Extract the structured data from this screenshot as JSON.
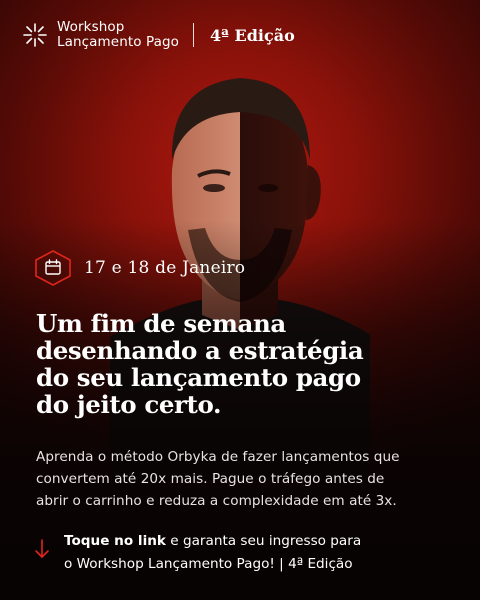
{
  "header": {
    "brand_line1": "Workshop",
    "brand_line2": "Lançamento Pago",
    "edition": "4ª Edição",
    "logo_icon": "starburst-icon"
  },
  "date": {
    "icon": "calendar-icon",
    "text": "17 e 18 de Janeiro"
  },
  "headline": {
    "line1": "Um fim de semana",
    "line2": "desenhando a estratégia",
    "line3": "do seu lançamento pago",
    "line4": "do jeito certo."
  },
  "description": {
    "line1": "Aprenda o método Orbyka de fazer lançamentos que",
    "line2": "convertem até 20x mais. Pague o tráfego antes de",
    "line3": "abrir o carrinho e reduza a complexidade em até 3x."
  },
  "cta": {
    "icon": "arrow-down-icon",
    "strong": "Toque no link",
    "line1_rest": " e garanta seu ingresso para",
    "line2": "o Workshop Lançamento Pago! | 4ª Edição"
  },
  "colors": {
    "accent": "#e0261b",
    "background_red": "#8a120a",
    "background_dark": "#070303"
  }
}
